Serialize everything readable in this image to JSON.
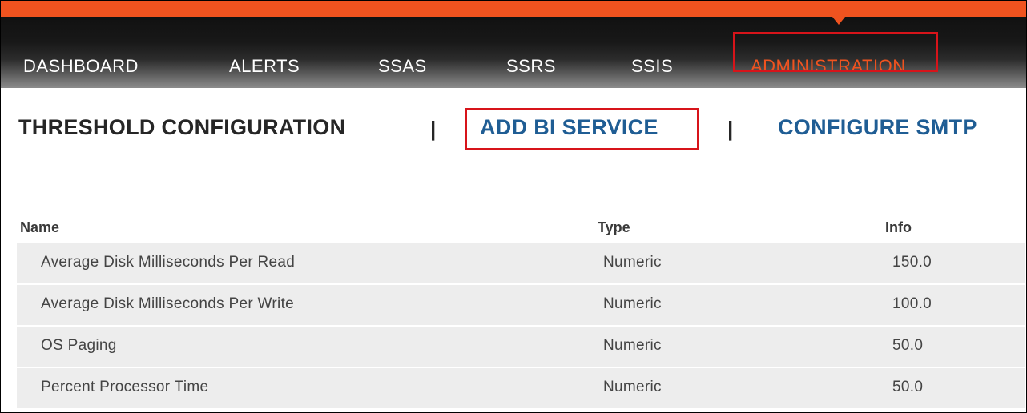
{
  "colors": {
    "accent": "#f0531f",
    "highlight_border": "#d7141a",
    "link": "#1f5d94",
    "row_background": "#ededed"
  },
  "nav": {
    "items": [
      {
        "label": "DASHBOARD"
      },
      {
        "label": "ALERTS"
      },
      {
        "label": "SSAS"
      },
      {
        "label": "SSRS"
      },
      {
        "label": "SSIS"
      },
      {
        "label": "ADMINISTRATION",
        "active": true
      }
    ]
  },
  "subnav": {
    "items": [
      {
        "label": "THRESHOLD CONFIGURATION"
      },
      {
        "label": "ADD BI SERVICE",
        "highlighted": true
      },
      {
        "label": "CONFIGURE SMTP"
      }
    ],
    "separator": "|"
  },
  "table": {
    "headers": {
      "name": "Name",
      "type": "Type",
      "info": "Info"
    },
    "rows": [
      {
        "name": "Average Disk Milliseconds Per Read",
        "type": "Numeric",
        "info": "150.0"
      },
      {
        "name": "Average Disk Milliseconds Per Write",
        "type": "Numeric",
        "info": "100.0"
      },
      {
        "name": "OS Paging",
        "type": "Numeric",
        "info": "50.0"
      },
      {
        "name": "Percent Processor Time",
        "type": "Numeric",
        "info": "50.0"
      }
    ]
  }
}
